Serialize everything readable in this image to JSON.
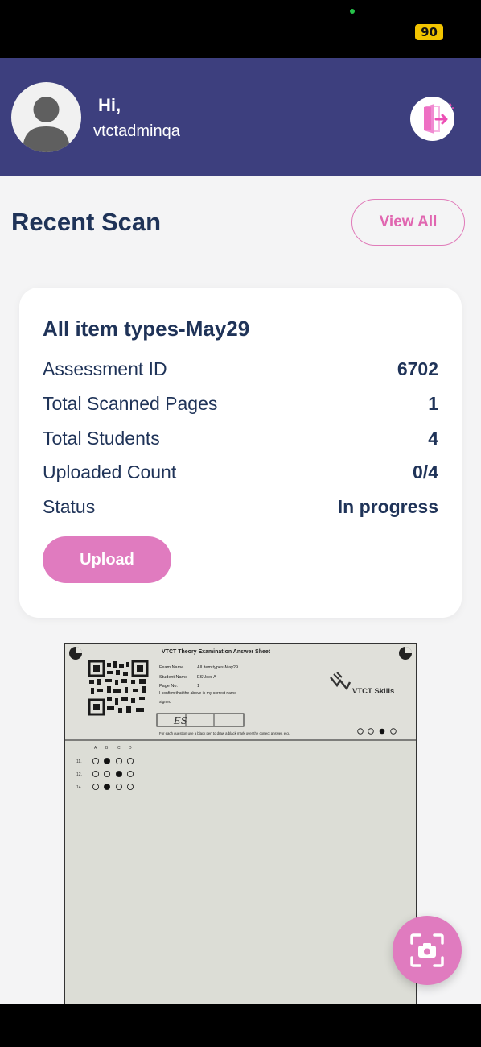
{
  "status_bar": {
    "battery": "90"
  },
  "header": {
    "greeting": "Hi,",
    "username": "vtctadminqa",
    "avatar_icon": "user-avatar-icon",
    "logout_icon": "logout-icon"
  },
  "recent_scan": {
    "title": "Recent Scan",
    "view_all_label": "View All"
  },
  "card": {
    "title": "All item types-May29",
    "rows": [
      {
        "label": "Assessment ID",
        "value": "6702"
      },
      {
        "label": "Total Scanned Pages",
        "value": "1"
      },
      {
        "label": "Total Students",
        "value": "4"
      },
      {
        "label": "Uploaded Count",
        "value": "0/4"
      },
      {
        "label": "Status",
        "value": "In progress"
      }
    ],
    "upload_label": "Upload"
  },
  "scan_sheet": {
    "heading": "VTCT Theory Examination Answer Sheet",
    "exam_name_label": "Exam Name",
    "exam_name_value": "All item types-May29",
    "student_name_label": "Student Name",
    "student_name_value": "ESUser A",
    "page_no_label": "Page No.",
    "page_no_value": "1",
    "confirm_text": "I confirm that the above is my correct name",
    "signed_label": "signed",
    "signature": "ES",
    "brand": "VTCT Skills",
    "instruction": "For each question use a black pen to draw a black mark over the correct answer, e.g.",
    "option_letters": [
      "A",
      "B",
      "C",
      "D"
    ],
    "questions": [
      {
        "number": "11.",
        "marked": [
          1
        ]
      },
      {
        "number": "12.",
        "marked": [
          2
        ]
      },
      {
        "number": "14.",
        "marked": [
          1
        ]
      }
    ]
  },
  "fab": {
    "icon": "camera-scan-icon"
  },
  "colors": {
    "header_bg": "#3d3f7e",
    "accent_pink": "#e07bbf",
    "text_navy": "#1f3358",
    "page_bg": "#f4f4f5"
  }
}
